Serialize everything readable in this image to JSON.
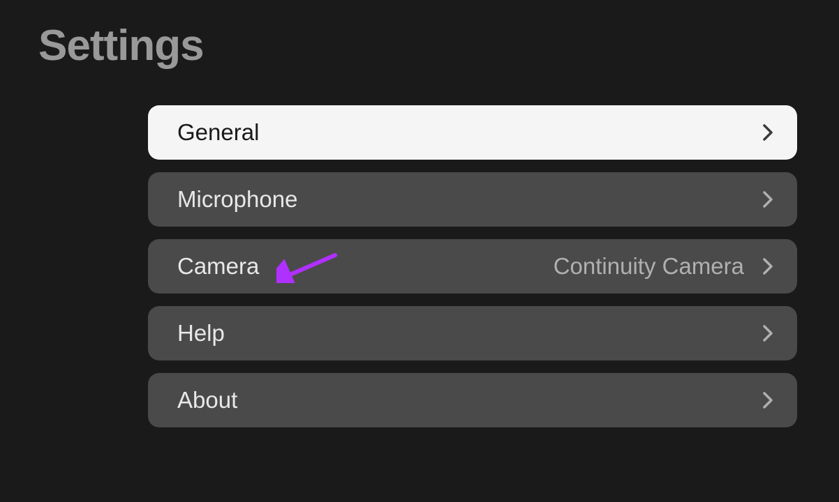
{
  "title": "Settings",
  "menu": {
    "items": [
      {
        "label": "General",
        "value": "",
        "selected": true
      },
      {
        "label": "Microphone",
        "value": "",
        "selected": false
      },
      {
        "label": "Camera",
        "value": "Continuity Camera",
        "selected": false
      },
      {
        "label": "Help",
        "value": "",
        "selected": false
      },
      {
        "label": "About",
        "value": "",
        "selected": false
      }
    ]
  },
  "annotation": {
    "target": "Camera",
    "color": "#b030ff"
  }
}
